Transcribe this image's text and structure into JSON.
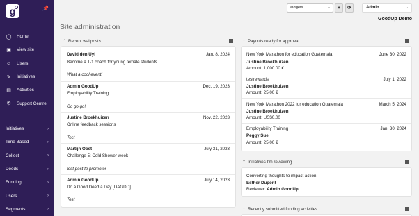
{
  "sidebar": {
    "logo": "g",
    "pin": "📌",
    "nav": [
      {
        "label": "Home",
        "icon": "◯"
      },
      {
        "label": "View site",
        "icon": "▣"
      },
      {
        "label": "Users",
        "icon": "☺"
      },
      {
        "label": "Initiatives",
        "icon": "✎"
      },
      {
        "label": "Activities",
        "icon": "▤"
      },
      {
        "label": "Support Centre",
        "icon": "✆"
      }
    ],
    "sections": [
      {
        "label": "Initiatives"
      },
      {
        "label": "Time Based"
      },
      {
        "label": "Collect"
      },
      {
        "label": "Deeds"
      },
      {
        "label": "Funding"
      },
      {
        "label": "Users"
      },
      {
        "label": "Segments"
      }
    ]
  },
  "topbar": {
    "widget_select": "widgets",
    "add_label": "+",
    "refresh_label": "⟳",
    "admin_label": "Admin",
    "org_name": "GoodUp Demo"
  },
  "page_title": "Site administration",
  "wallposts": {
    "title": "Recent wallposts",
    "items": [
      {
        "author": "David den Uyl",
        "date": "Jan. 8, 2024",
        "subject": "Become a 1-1 coach for young female students",
        "message": "What a cool event!"
      },
      {
        "author": "Admin GoodUp",
        "date": "Dec. 19, 2023",
        "subject": "Employability Training",
        "message": "Go go go!"
      },
      {
        "author": "Justine Broekhuizen",
        "date": "Nov. 22, 2023",
        "subject": "Online feedback sessions",
        "message": "Test"
      },
      {
        "author": "Martijn Oost",
        "date": "July 31, 2023",
        "subject": "Challenge 5: Cold Shower week",
        "message": "test post to promoter"
      },
      {
        "author": "Admin GoodUp",
        "date": "July 14, 2023",
        "subject": "Do a Good Deed a Day [DAGDD]",
        "message": "Test"
      }
    ]
  },
  "payouts": {
    "title": "Payouts ready for approval",
    "items": [
      {
        "activity": "New York Marathon for education Guatemala",
        "date": "June 30, 2022",
        "person": "Justine Broekhuizen",
        "amount": "Amount: 1,000.00 €"
      },
      {
        "activity": "testrewards",
        "date": "July 1, 2022",
        "person": "Justine Broekhuizen",
        "amount": "Amount: 25.00 €"
      },
      {
        "activity": "New York Marathon 2022 for education Guatemala",
        "date": "March 5, 2024",
        "person": "Justine Broekhuizen",
        "amount": "Amount: US$0.00"
      },
      {
        "activity": "Employability Training",
        "date": "Jan. 30, 2024",
        "person": "Peggy Sue",
        "amount": "Amount: 25.00 €"
      }
    ]
  },
  "reviewing": {
    "title": "Initiatives I'm reviewing",
    "item": {
      "title": "Converting thoughts to impact action",
      "person": "Esther Dupont",
      "reviewer_label": "Reviewer:",
      "reviewer": "Admin GoodUp"
    }
  },
  "funding": {
    "title": "Recently submitted funding activities"
  }
}
